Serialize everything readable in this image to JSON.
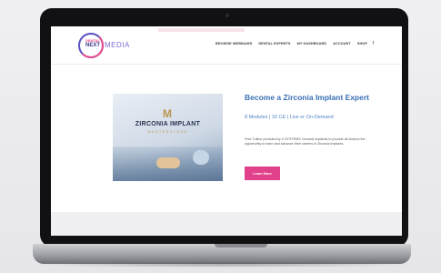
{
  "header": {
    "logo": {
      "line1": "DENTAL",
      "line2": "NEXT",
      "brand_text": "MEDIA"
    },
    "nav": [
      "BROWSE WEBINARS",
      "DENTAL EXPERTS",
      "MY DASHBOARD",
      "ACCOUNT",
      "SHOP"
    ],
    "nav_extra": "f"
  },
  "hero": {
    "image_title": "ZIRCONIA IMPLANT",
    "image_subtitle": "MASTERCLASS",
    "image_mark": "M"
  },
  "course": {
    "title": "Become a Zirconia Implant Expert",
    "meta": "8 Modules | 16 CE | Live or On-Demand",
    "description": "Free Tuition provided by Z-SYSTEMS Ceramic Implants to provide all doctors the opportunity to learn and advance their careers in Zirconia Implants.",
    "button_label": "Learn More"
  },
  "colors": {
    "accent_pink": "#e0418a",
    "title_blue": "#3a6fb5",
    "logo_purple": "#5a4fc4"
  }
}
